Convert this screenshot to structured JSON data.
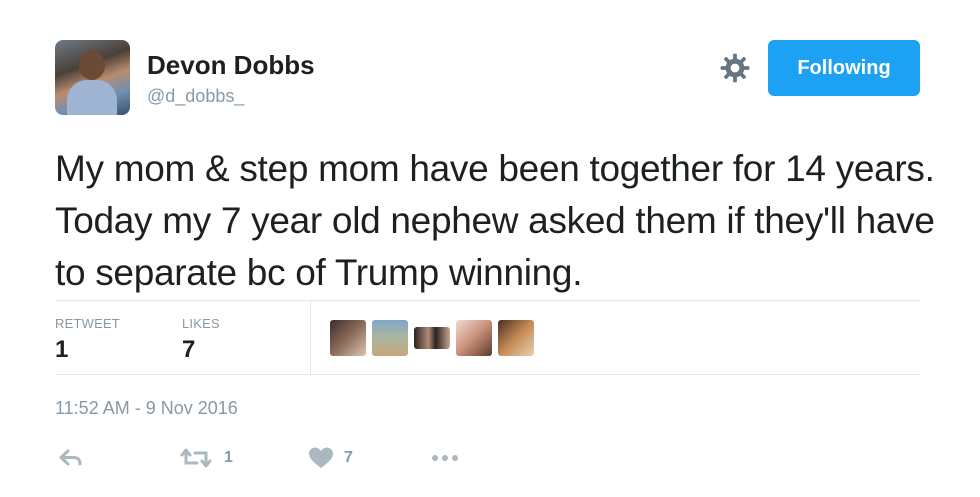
{
  "author": {
    "display_name": "Devon Dobbs",
    "handle": "@d_dobbs_"
  },
  "header": {
    "follow_button_label": "Following",
    "settings_icon": "gear-icon"
  },
  "tweet": {
    "text": "My mom & step mom have been together for 14 years. Today my 7 year old nephew asked them if they'll have to separate bc of Trump winning.",
    "timestamp": "11:52 AM - 9 Nov 2016"
  },
  "stats": {
    "retweets_label": "RETWEET",
    "retweets_value": "1",
    "likes_label": "LIKES",
    "likes_value": "7"
  },
  "likers": [
    {
      "name": "liker-avatar-1"
    },
    {
      "name": "liker-avatar-2"
    },
    {
      "name": "liker-avatar-3"
    },
    {
      "name": "liker-avatar-4"
    },
    {
      "name": "liker-avatar-5"
    }
  ],
  "actions": {
    "reply_icon": "reply-icon",
    "retweet_icon": "retweet-icon",
    "retweet_count": "1",
    "like_icon": "heart-icon",
    "like_count": "7",
    "more_icon": "more-icon"
  },
  "colors": {
    "accent": "#1da1f2",
    "muted": "#8899a6",
    "text": "#1c2022",
    "divider": "#e1e8ed"
  }
}
